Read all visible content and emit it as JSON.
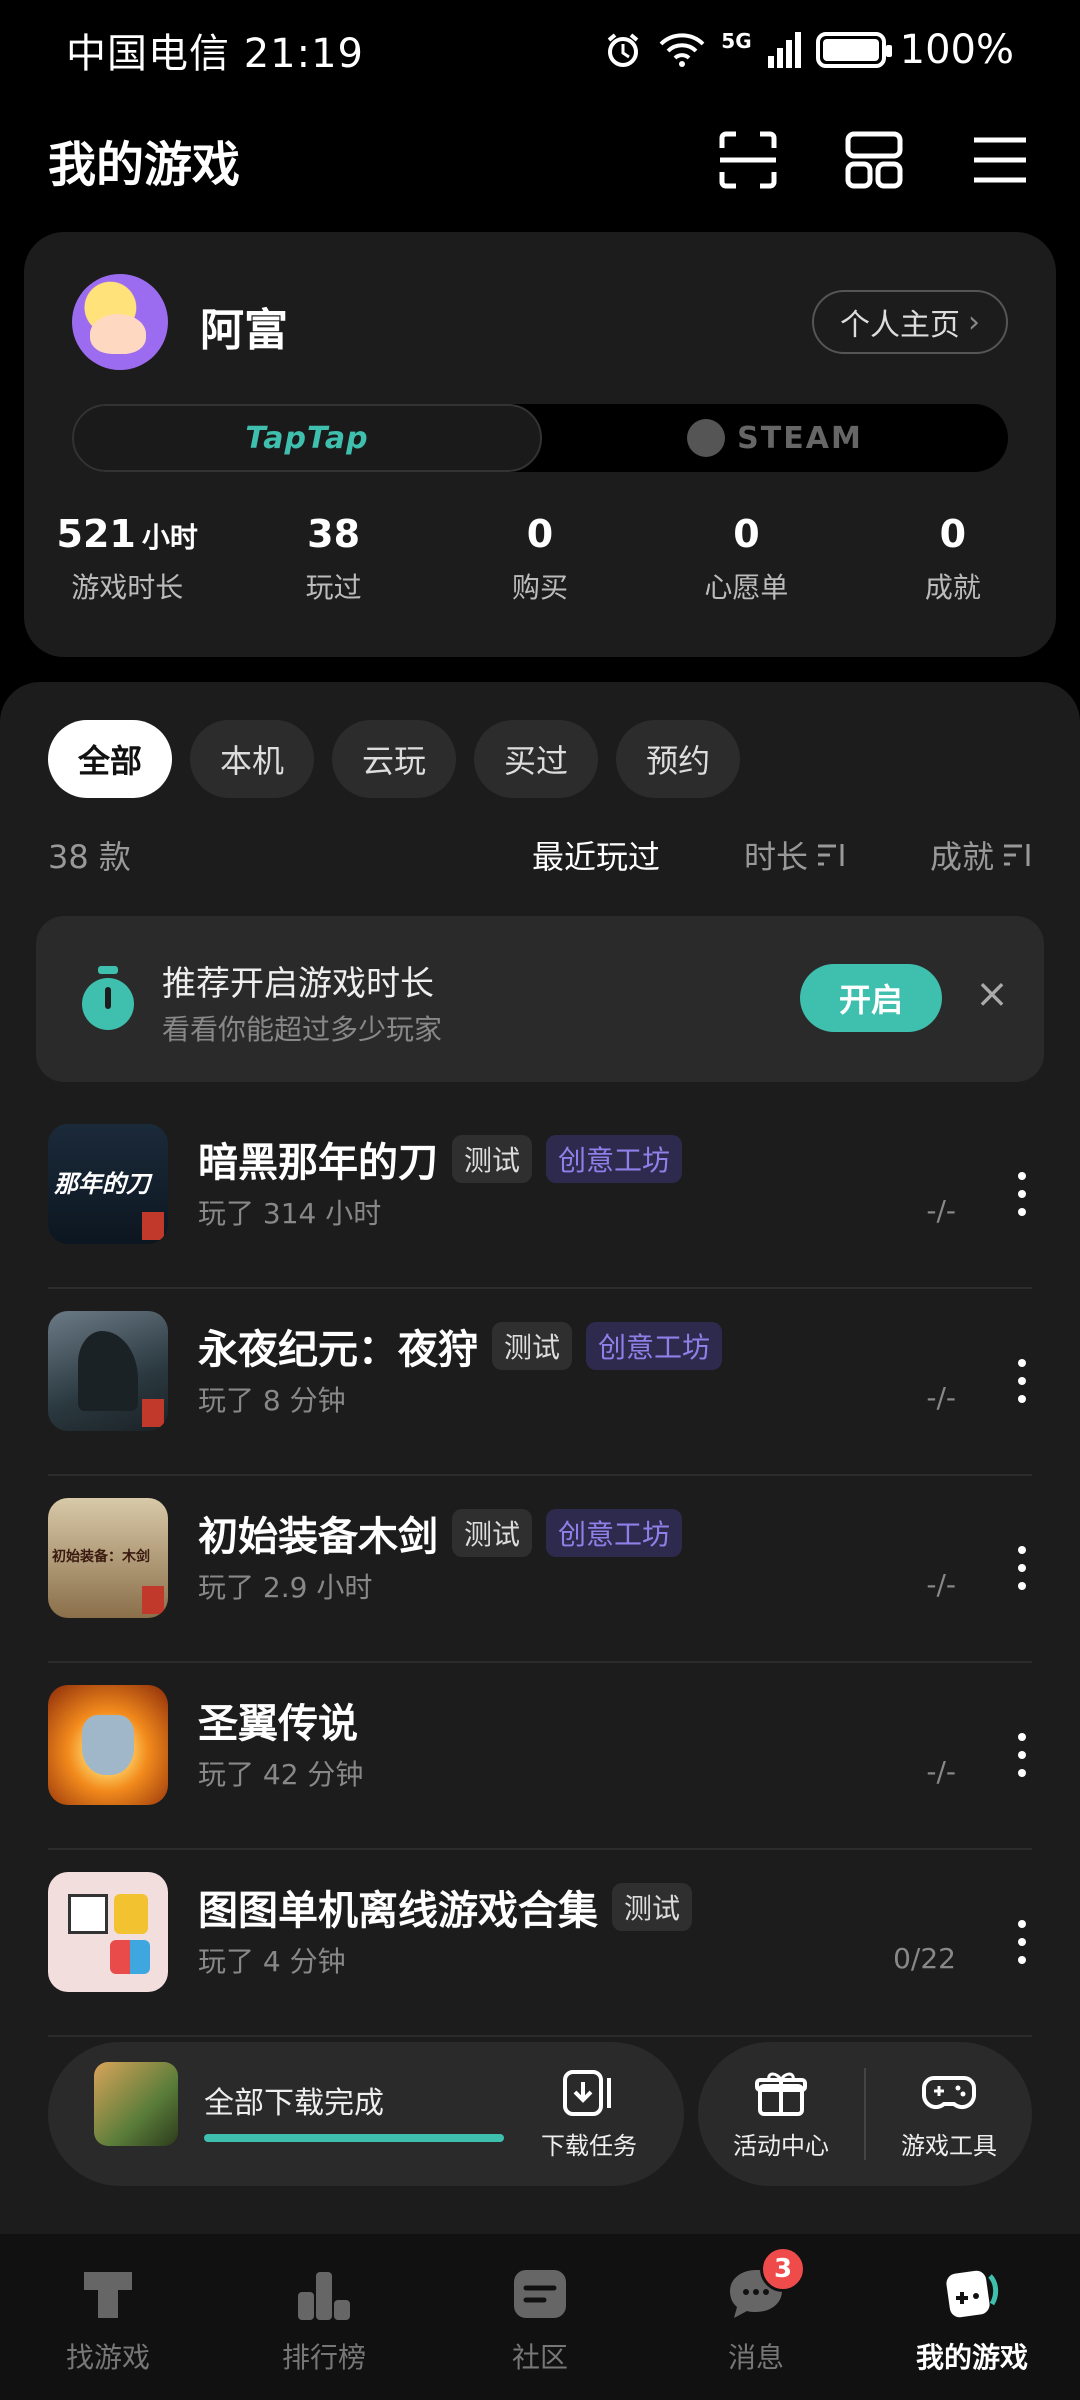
{
  "status_bar": {
    "carrier_time": "中国电信 21:19",
    "network": "5G",
    "battery": "100%",
    "battery_level": 1.0
  },
  "header": {
    "title": "我的游戏"
  },
  "profile": {
    "username": "阿富",
    "homepage_label": "个人主页",
    "platforms": [
      "TapTap",
      "STEAM"
    ],
    "active_platform": "TapTap",
    "stats": [
      {
        "value": "521",
        "unit": "小时",
        "label": "游戏时长"
      },
      {
        "value": "38",
        "unit": "",
        "label": "玩过"
      },
      {
        "value": "0",
        "unit": "",
        "label": "购买"
      },
      {
        "value": "0",
        "unit": "",
        "label": "心愿单"
      },
      {
        "value": "0",
        "unit": "",
        "label": "成就"
      }
    ]
  },
  "filters": {
    "chips": [
      "全部",
      "本机",
      "云玩",
      "买过",
      "预约"
    ],
    "active": "全部"
  },
  "sort": {
    "count": "38 款",
    "options": [
      "最近玩过",
      "时长",
      "成就"
    ],
    "active": "最近玩过"
  },
  "banner": {
    "title": "推荐开启游戏时长",
    "subtitle": "看看你能超过多少玩家",
    "button": "开启",
    "close": "×"
  },
  "games": [
    {
      "name": "暗黑那年的刀",
      "tags": [
        "测试",
        "创意工坊"
      ],
      "played": "玩了 314 小时",
      "achievement": "-/-"
    },
    {
      "name": "永夜纪元：夜狩",
      "tags": [
        "测试",
        "创意工坊"
      ],
      "played": "玩了 8 分钟",
      "achievement": "-/-"
    },
    {
      "name": "初始装备木剑",
      "tags": [
        "测试",
        "创意工坊"
      ],
      "played": "玩了 2.9 小时",
      "achievement": "-/-"
    },
    {
      "name": "圣翼传说",
      "tags": [],
      "played": "玩了 42 分钟",
      "achievement": "-/-"
    },
    {
      "name": "图图单机离线游戏合集",
      "tags": [
        "测试"
      ],
      "played": "玩了 4 分钟",
      "achievement": "0/22"
    }
  ],
  "game_thumb_text": {
    "g0": "那年的刀",
    "g2": "初始装备：木剑"
  },
  "download": {
    "text": "全部下载完成",
    "progress": 1.0,
    "task_label": "下载任务"
  },
  "tools": [
    "活动中心",
    "游戏工具"
  ],
  "bottom_nav": {
    "items": [
      "找游戏",
      "排行榜",
      "社区",
      "消息",
      "我的游戏"
    ],
    "active": "我的游戏",
    "message_badge": "3"
  },
  "colors": {
    "accent": "#3fbfae",
    "workshop": "#8d80e8",
    "badge": "#f04b4b"
  }
}
